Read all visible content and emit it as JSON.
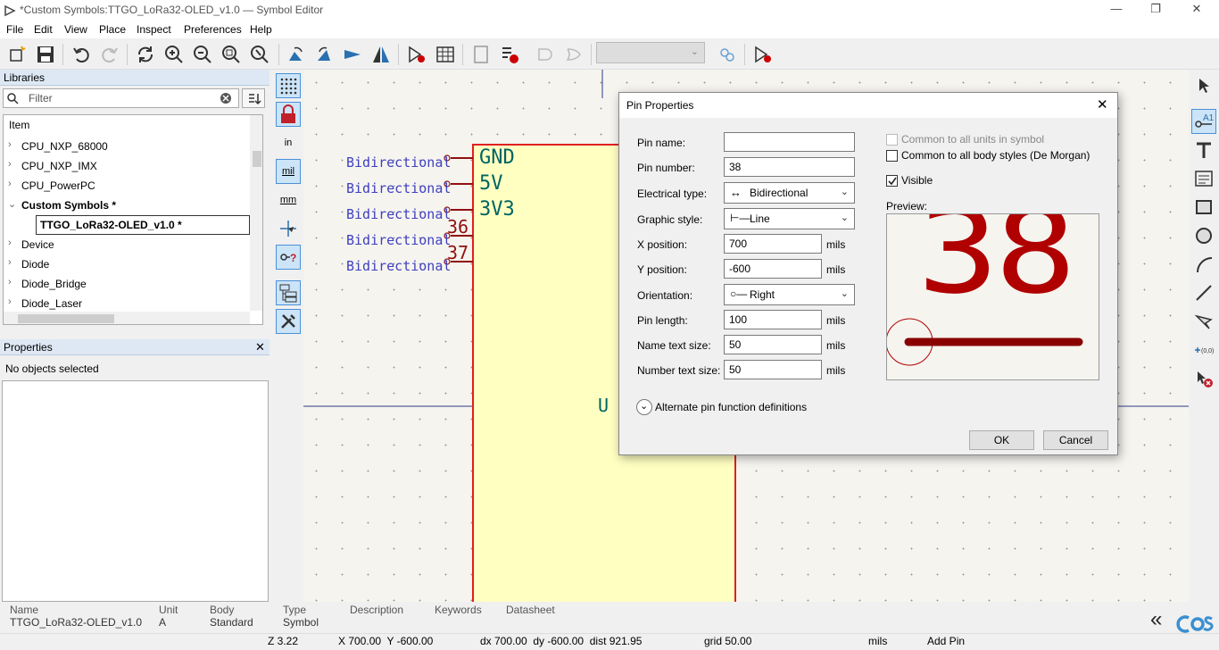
{
  "window": {
    "title": "*Custom Symbols:TTGO_LoRa32-OLED_v1.0 — Symbol Editor",
    "min": "—",
    "restore": "❐",
    "close": "✕"
  },
  "menu": [
    "File",
    "Edit",
    "View",
    "Place",
    "Inspect",
    "Preferences",
    "Help"
  ],
  "libraries": {
    "header": "Libraries",
    "filter_placeholder": "Filter",
    "column": "Item",
    "items": [
      {
        "label": "CPU_NXP_68000"
      },
      {
        "label": "CPU_NXP_IMX"
      },
      {
        "label": "CPU_PowerPC"
      },
      {
        "label": "Custom Symbols *"
      },
      {
        "label": "TTGO_LoRa32-OLED_v1.0 *"
      },
      {
        "label": "Device"
      },
      {
        "label": "Diode"
      },
      {
        "label": "Diode_Bridge"
      },
      {
        "label": "Diode_Laser"
      }
    ]
  },
  "properties": {
    "header": "Properties",
    "empty": "No objects selected"
  },
  "left_toolbar": {
    "in": "in",
    "mil": "mil",
    "mm": "mm"
  },
  "canvas": {
    "pin_types": [
      "Bidirectional",
      "Bidirectional",
      "Bidirectional",
      "Bidirectional",
      "Bidirectional"
    ],
    "pin_names": [
      "GND",
      "5V",
      "3V3"
    ],
    "pin_numbers": [
      "36",
      "37"
    ],
    "unit_label": "U",
    "colors": {
      "body_fill": "#ffffc2",
      "body_border": "#e02020",
      "pin": "#901010",
      "text": "#006464",
      "electrical": "#4040c0"
    }
  },
  "dialog": {
    "title": "Pin Properties",
    "pin_name_label": "Pin name:",
    "pin_name_value": "",
    "pin_number_label": "Pin number:",
    "pin_number_value": "38",
    "electrical_type_label": "Electrical type:",
    "electrical_type_value": "Bidirectional",
    "graphic_style_label": "Graphic style:",
    "graphic_style_value": "Line",
    "x_label": "X position:",
    "x_value": "700",
    "y_label": "Y position:",
    "y_value": "-600",
    "orientation_label": "Orientation:",
    "orientation_value": "Right",
    "pin_length_label": "Pin length:",
    "pin_length_value": "100",
    "name_size_label": "Name text size:",
    "name_size_value": "50",
    "number_size_label": "Number text size:",
    "number_size_value": "50",
    "unit": "mils",
    "common_units": "Common to all units in symbol",
    "common_styles": "Common to all body styles (De Morgan)",
    "visible": "Visible",
    "preview_label": "Preview:",
    "preview_number": "38",
    "alternate": "Alternate pin function definitions",
    "ok": "OK",
    "cancel": "Cancel"
  },
  "status": {
    "headers": {
      "name": "Name",
      "unit": "Unit",
      "body": "Body",
      "type": "Type",
      "description": "Description",
      "keywords": "Keywords",
      "datasheet": "Datasheet"
    },
    "values": {
      "name": "TTGO_LoRa32-OLED_v1.0",
      "unit": "A",
      "body": "Standard",
      "type": "Symbol"
    },
    "zoom": "Z 3.22",
    "xy": "X 700.00  Y -600.00",
    "dxy": "dx 700.00  dy -600.00  dist 921.95",
    "grid": "grid 50.00",
    "units": "mils",
    "mode": "Add Pin"
  }
}
